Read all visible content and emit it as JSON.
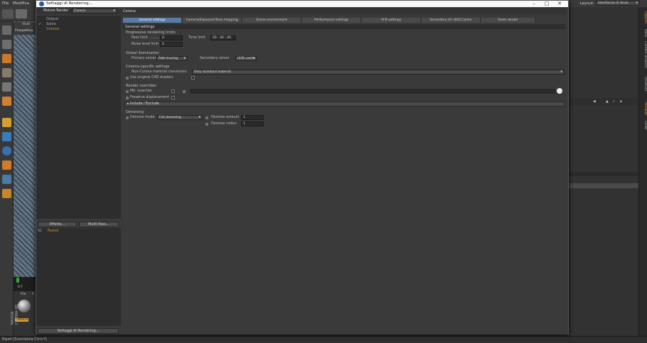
{
  "app": {
    "menu": [
      "File",
      "Modifica"
    ],
    "layout_label": "Layout:",
    "layout_value": "Interfaccia di Avvio",
    "statusbar": "Ripeti [Scorciatoia Ctrl+Y]",
    "viewport_tabs": [
      "Viste",
      "Prospettiva"
    ],
    "timeline_frame": "0 F",
    "materials_tabs": [
      "File",
      "C"
    ],
    "material_name": "Materia",
    "brand": "MAXON CINEMA 4D",
    "right_tabs": [
      "Oggetti",
      "Takes",
      "Content Browser",
      "Struttura",
      "Attributi",
      "Strati"
    ]
  },
  "dialog": {
    "title": "Settaggi di Rendering...",
    "renderer_label": "Motore Render",
    "renderer_value": "Corona",
    "tree": [
      "Output",
      "Salva",
      "Corona"
    ],
    "tree_checked": "✓",
    "effects_button": "Effetto...",
    "multipass_button": "Multi-Pass...",
    "preset_label": "Nuovo",
    "preset_prefix": "SC",
    "footer_button": "Settaggi di Rendering...",
    "header": "Corona",
    "tabs": [
      "General settings",
      "Camera/Exposure/Tone mapping",
      "Scene environment",
      "Performance settings",
      "VFB settings",
      "Secondary GI: UHD Cache",
      "Team render"
    ],
    "active_tab": "General settings",
    "general": {
      "title": "General settings",
      "progressive_header": "Progressive rendering limits",
      "pass_limit_label": "Pass limit ..........",
      "pass_limit_value": "0",
      "time_limit_label": "Time limit",
      "time_limit_value": "00 : 00 : 00",
      "noise_label": "Noise level limit",
      "noise_value": "0",
      "gi_header": "Global illumination",
      "primary_label": "Primary solver",
      "primary_value": "Path tracing",
      "secondary_label": "Secondary solver",
      "secondary_value": "UHD cache",
      "cinema_header": "Cinema-specific settings",
      "conversion_label": "Non-Corona material conversion",
      "conversion_value": "Only standard material",
      "shaders_label": "Use original C4D shaders",
      "override_header": "Render overrides",
      "mtl_override_label": "Mtl. override",
      "preserve_label": "Preserve displacement",
      "include_label": "▸ Include / Exclude",
      "denoise_header": "Denoising",
      "denoise_mode_label": "Denoise mode",
      "denoise_mode_value": "Full denoising",
      "denoise_amount_label": "Denoise amount",
      "denoise_amount_value": "1",
      "denoise_radius_label": "Denoise radius",
      "denoise_radius_value": "1"
    }
  }
}
